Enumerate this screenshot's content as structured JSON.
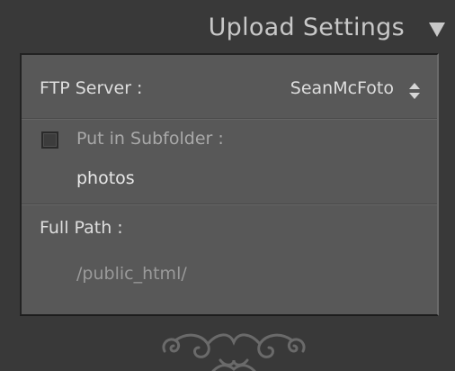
{
  "header": {
    "title": "Upload Settings",
    "collapse_icon": "triangle-down-icon"
  },
  "ftp_server": {
    "label": "FTP Server :",
    "value": "SeanMcFoto",
    "stepper_icon": "up-down-stepper-icon"
  },
  "subfolder": {
    "checked": false,
    "label": "Put in Subfolder :",
    "value": "photos"
  },
  "full_path": {
    "label": "Full Path :",
    "value": "/public_html/"
  },
  "colors": {
    "background": "#393939",
    "panel": "#585858",
    "text": "#dedede",
    "muted_text": "#9a9a9a"
  }
}
